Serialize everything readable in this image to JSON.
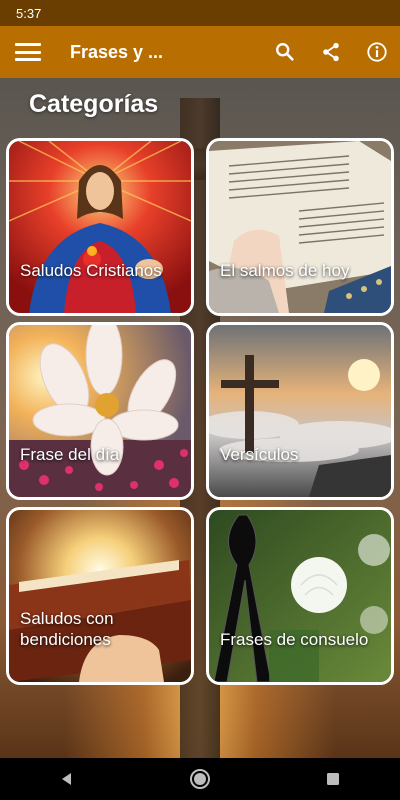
{
  "status_bar": {
    "time": "5:37"
  },
  "app_bar": {
    "title": "Frases y ...",
    "icons": [
      "menu-icon",
      "search-icon",
      "share-icon",
      "info-icon"
    ]
  },
  "heading": "Categorías",
  "categories": [
    {
      "label": "Saludos Cristianos",
      "image": "jesus-sacred-heart"
    },
    {
      "label": "El salmos de hoy",
      "image": "hands-open-bible"
    },
    {
      "label": "Frase del día",
      "image": "white-flower-sunset"
    },
    {
      "label": "Versículos",
      "image": "cross-above-clouds"
    },
    {
      "label": "Saludos con bendiciones",
      "image": "bible-in-hand-sunlight"
    },
    {
      "label": "Frases de consuelo",
      "image": "black-ribbon-white-rose"
    }
  ],
  "nav_bar": {
    "icons": [
      "back-icon",
      "home-icon",
      "recents-icon"
    ]
  },
  "colors": {
    "status_bar": "#6a3d00",
    "app_bar": "#b86e00",
    "card_border": "#ffffff"
  }
}
